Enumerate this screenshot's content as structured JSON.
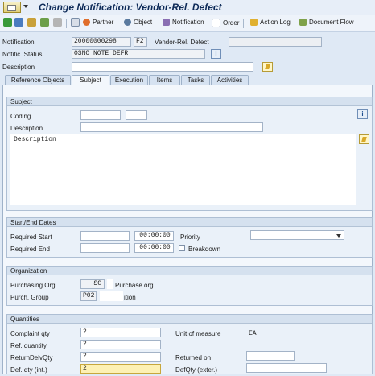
{
  "window": {
    "title": "Change Notification: Vendor-Rel. Defect"
  },
  "toolbar": {
    "partner": "Partner",
    "object": "Object",
    "notification": "Notification",
    "order": "Order",
    "action_log": "Action Log",
    "document_flow": "Document Flow"
  },
  "header": {
    "notification_label": "Notification",
    "notification_value": "20000000298",
    "notif_type": "F2",
    "notif_type_text": "Vendor-Rel. Defect",
    "status_label": "Notific. Status",
    "status_value": "OSNO NOTE DEFR",
    "info_glyph": "i",
    "description_label": "Description"
  },
  "tabs": [
    "Reference Objects",
    "Subject",
    "Execution",
    "Items",
    "Tasks",
    "Activities"
  ],
  "subject": {
    "title": "Subject",
    "coding_label": "Coding",
    "description_label": "Description",
    "longtext": "Description"
  },
  "dates": {
    "title": "Start/End Dates",
    "required_start_label": "Required Start",
    "required_start_time": "00:00:00",
    "required_end_label": "Required End",
    "required_end_time": "00:00:00",
    "priority_label": "Priority",
    "breakdown_label": "Breakdown"
  },
  "organization": {
    "title": "Organization",
    "purch_org_label": "Purchasing Org.",
    "purch_org_value": "SC",
    "purch_org_text": "Purchase org.",
    "purch_group_label": "Purch. Group",
    "purch_group_value": "P02",
    "purch_group_text": "ition"
  },
  "quantities": {
    "title": "Quantities",
    "complaint_label": "Complaint qty",
    "complaint_value": "2",
    "unit_label": "Unit of measure",
    "unit_value": "EA",
    "ref_label": "Ref. quantity",
    "ref_value": "2",
    "return_label": "ReturnDelvQty",
    "return_value": "2",
    "returned_on_label": "Returned on",
    "def_int_label": "Def. qty (int.)",
    "def_int_value": "2",
    "def_ext_label": "DefQty (exter.)"
  },
  "colors": {
    "title": "#0d2a58",
    "background": "#dfe9f5",
    "focus_field": "#fdf1b4"
  }
}
